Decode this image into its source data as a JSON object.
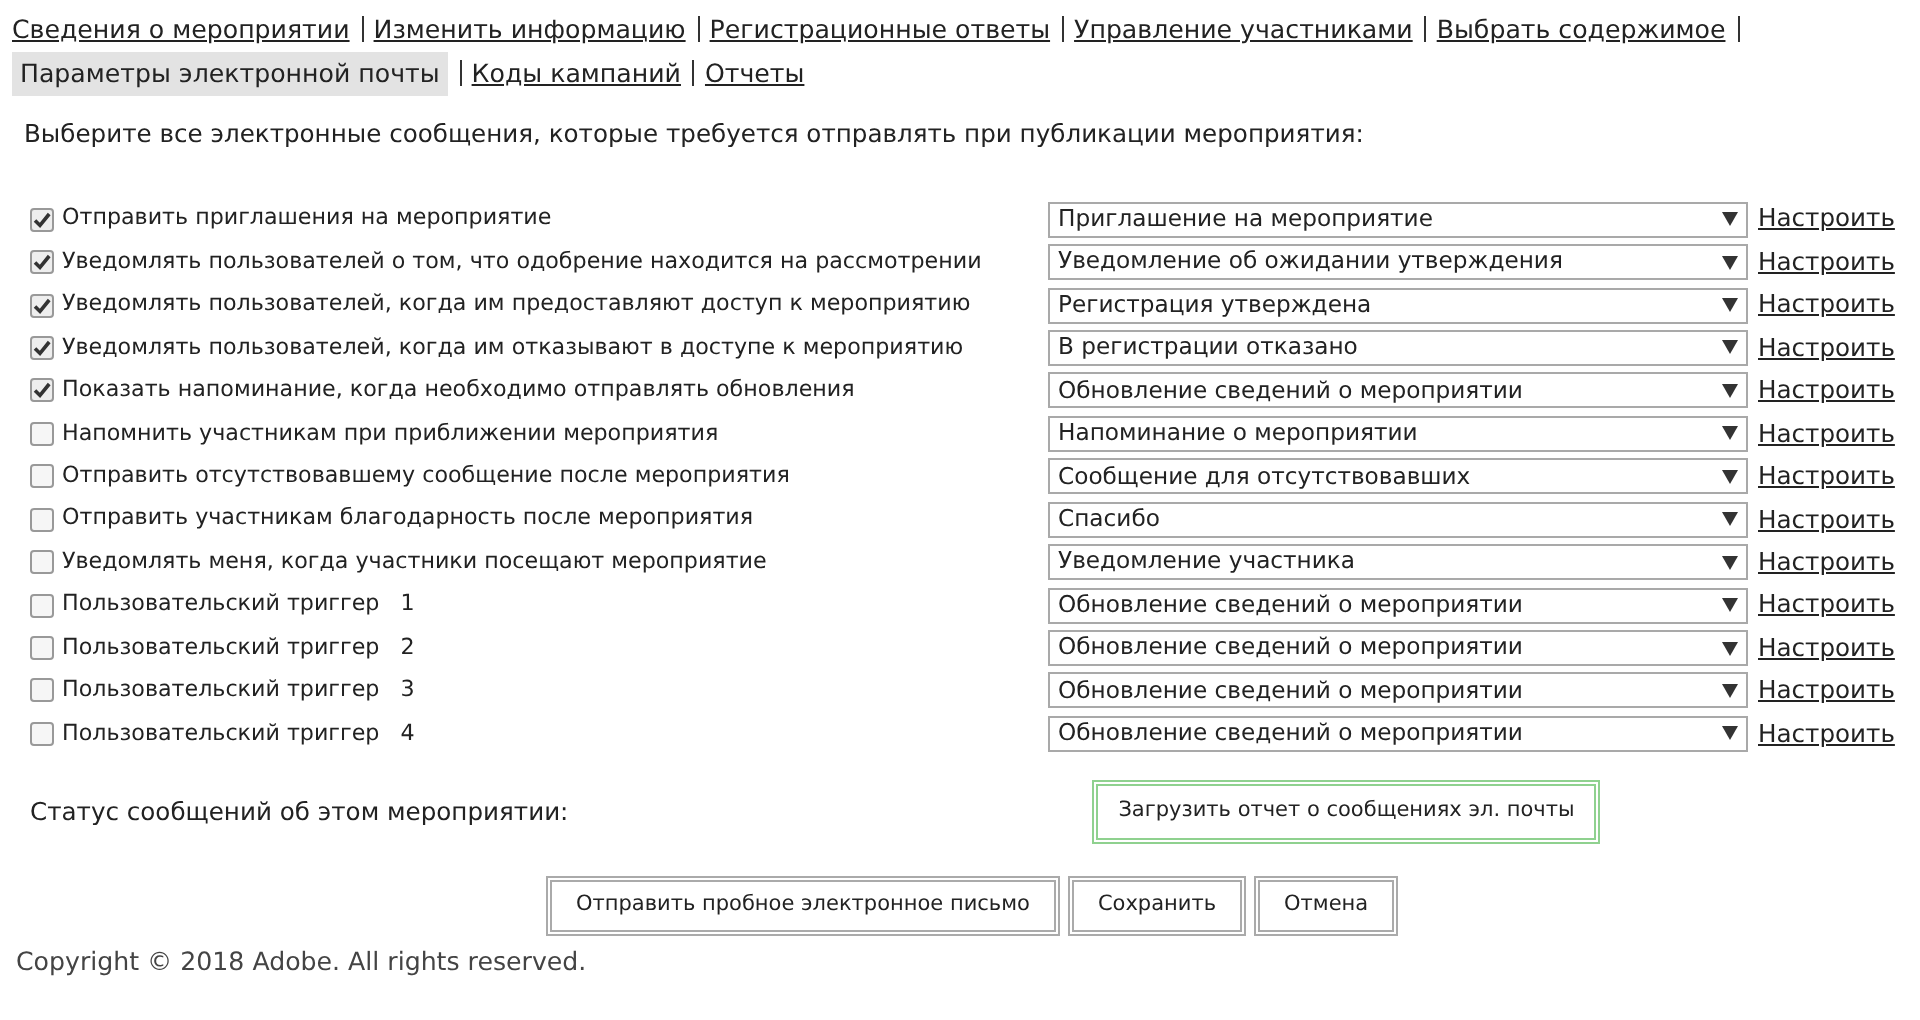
{
  "nav": [
    {
      "label": "Сведения о мероприятии",
      "selected": false
    },
    {
      "label": "Изменить информацию",
      "selected": false
    },
    {
      "label": "Регистрационные ответы",
      "selected": false
    },
    {
      "label": "Управление участниками",
      "selected": false
    },
    {
      "label": "Выбрать содержимое",
      "selected": false
    },
    {
      "label": "Параметры электронной почты",
      "selected": true
    },
    {
      "label": "Коды кампаний",
      "selected": false
    },
    {
      "label": "Отчеты",
      "selected": false
    }
  ],
  "instruction": "Выберите все электронные сообщения, которые требуется отправлять при публикации мероприятия:",
  "messages": [
    {
      "label": "Отправить приглашения на мероприятие",
      "checked": true,
      "template": "Приглашение на мероприятие",
      "link": "Настроить"
    },
    {
      "label": "Уведомлять пользователей о том, что одобрение находится на рассмотрении",
      "checked": true,
      "template": "Уведомление об ожидании утверждения",
      "link": "Настроить"
    },
    {
      "label": "Уведомлять пользователей, когда им предоставляют доступ к мероприятию",
      "checked": true,
      "template": "Регистрация утверждена",
      "link": "Настроить"
    },
    {
      "label": "Уведомлять пользователей, когда им отказывают в доступе к мероприятию",
      "checked": true,
      "template": "В регистрации отказано",
      "link": "Настроить"
    },
    {
      "label": "Показать напоминание, когда необходимо отправлять обновления",
      "checked": true,
      "template": "Обновление сведений о мероприятии",
      "link": "Настроить"
    },
    {
      "label": "Напомнить участникам при приближении мероприятия",
      "checked": false,
      "template": "Напоминание о мероприятии",
      "link": "Настроить"
    },
    {
      "label": "Отправить отсутствовавшему сообщение после мероприятия",
      "checked": false,
      "template": "Сообщение для отсутствовавших",
      "link": "Настроить"
    },
    {
      "label": "Отправить участникам благодарность после мероприятия",
      "checked": false,
      "template": "Спасибо",
      "link": "Настроить"
    },
    {
      "label": "Уведомлять меня, когда участники посещают мероприятие",
      "checked": false,
      "template": "Уведомление участника",
      "link": "Настроить"
    },
    {
      "label": "Пользовательский триггер   1",
      "checked": false,
      "template": "Обновление сведений о мероприятии",
      "link": "Настроить"
    },
    {
      "label": "Пользовательский триггер   2",
      "checked": false,
      "template": "Обновление сведений о мероприятии",
      "link": "Настроить"
    },
    {
      "label": "Пользовательский триггер   3",
      "checked": false,
      "template": "Обновление сведений о мероприятии",
      "link": "Настроить"
    },
    {
      "label": "Пользовательский триггер   4",
      "checked": false,
      "template": "Обновление сведений о мероприятии",
      "link": "Настроить"
    }
  ],
  "status": {
    "label": "Статус сообщений об этом мероприятии:",
    "button": "Загрузить отчет о сообщениях эл. почты"
  },
  "buttons": [
    "Отправить пробное электронное письмо",
    "Сохранить",
    "Отмена"
  ],
  "footer": "Copyright © 2018 Adobe. All rights reserved."
}
